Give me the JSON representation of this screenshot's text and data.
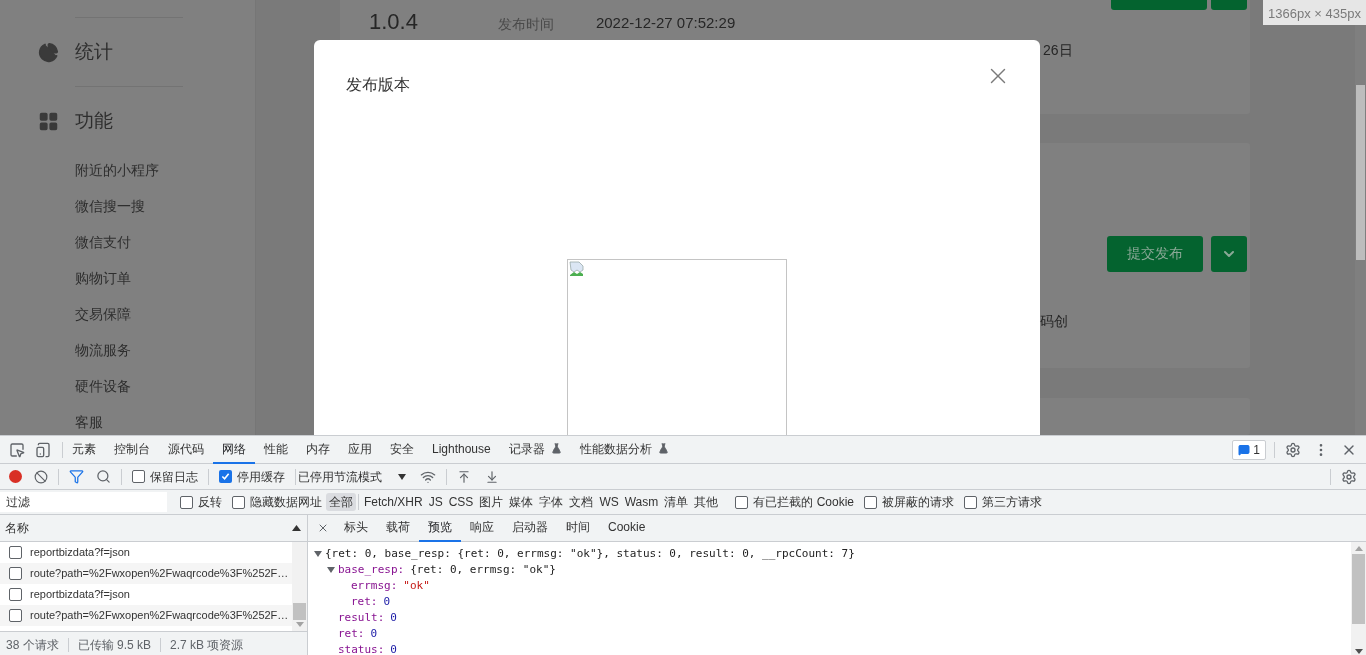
{
  "viewport_size": "1366px × 435px",
  "sidebar": {
    "groups": [
      {
        "kind": "stats",
        "label": "统计"
      },
      {
        "kind": "features",
        "label": "功能",
        "items": [
          "附近的小程序",
          "微信搜一搜",
          "微信支付",
          "购物订单",
          "交易保障",
          "物流服务",
          "硬件设备",
          "客服"
        ]
      }
    ]
  },
  "page": {
    "version": "1.0.4",
    "publish_time_label": "发布时间",
    "publish_time": "2022-12-27 07:52:29",
    "date_fragment": "26日",
    "text_fragment": "码创",
    "submit_button": "提交发布"
  },
  "dialog": {
    "title": "发布版本"
  },
  "devtools": {
    "tabs": [
      {
        "label": "元素",
        "selected": false,
        "experimental": false
      },
      {
        "label": "控制台",
        "selected": false,
        "experimental": false
      },
      {
        "label": "源代码",
        "selected": false,
        "experimental": false
      },
      {
        "label": "网络",
        "selected": true,
        "experimental": false
      },
      {
        "label": "性能",
        "selected": false,
        "experimental": false
      },
      {
        "label": "内存",
        "selected": false,
        "experimental": false
      },
      {
        "label": "应用",
        "selected": false,
        "experimental": false
      },
      {
        "label": "安全",
        "selected": false,
        "experimental": false
      },
      {
        "label": "Lighthouse",
        "selected": false,
        "experimental": false
      },
      {
        "label": "记录器",
        "selected": false,
        "experimental": true
      },
      {
        "label": "性能数据分析",
        "selected": false,
        "experimental": true
      }
    ],
    "issues_count": "1",
    "toolbar": {
      "recording": true,
      "filter_on": true,
      "checks": [
        {
          "label": "保留日志",
          "checked": false
        },
        {
          "label": "停用缓存",
          "checked": true
        }
      ],
      "throttling": "已停用节流模式"
    },
    "filter": {
      "placeholder": "过滤",
      "checks": [
        {
          "label": "反转",
          "checked": false
        },
        {
          "label": "隐藏数据网址",
          "checked": false
        }
      ],
      "types": [
        {
          "label": "全部",
          "selected": true
        },
        {
          "label": "Fetch/XHR",
          "selected": false
        },
        {
          "label": "JS",
          "selected": false
        },
        {
          "label": "CSS",
          "selected": false
        },
        {
          "label": "图片",
          "selected": false
        },
        {
          "label": "媒体",
          "selected": false
        },
        {
          "label": "字体",
          "selected": false
        },
        {
          "label": "文档",
          "selected": false
        },
        {
          "label": "WS",
          "selected": false
        },
        {
          "label": "Wasm",
          "selected": false
        },
        {
          "label": "清单",
          "selected": false
        },
        {
          "label": "其他",
          "selected": false
        }
      ],
      "extra_checks": [
        {
          "label": "有已拦截的 Cookie",
          "checked": false
        },
        {
          "label": "被屏蔽的请求",
          "checked": false
        },
        {
          "label": "第三方请求",
          "checked": false
        }
      ]
    },
    "requests": {
      "header": "名称",
      "rows": [
        {
          "name": "reportbizdata?f=json",
          "checked": false
        },
        {
          "name": "route?path=%2Fwxopen%2Fwaqrcode%3F%252F…",
          "checked": false
        },
        {
          "name": "reportbizdata?f=json",
          "checked": false
        },
        {
          "name": "route?path=%2Fwxopen%2Fwaqrcode%3F%252F…",
          "checked": false
        }
      ]
    },
    "status": [
      "38 个请求",
      "已传输 9.5 kB",
      "2.7 kB 项资源"
    ],
    "detail_tabs": [
      {
        "label": "标头",
        "selected": false
      },
      {
        "label": "载荷",
        "selected": false
      },
      {
        "label": "预览",
        "selected": true
      },
      {
        "label": "响应",
        "selected": false
      },
      {
        "label": "启动器",
        "selected": false
      },
      {
        "label": "时间",
        "selected": false
      },
      {
        "label": "Cookie",
        "selected": false
      }
    ],
    "preview": [
      {
        "kind": "object",
        "preview": "{ret: 0, base_resp: {ret: 0, errmsg: \"ok\"}, status: 0, result: 0, __rpcCount: 7}",
        "expanded": true,
        "children": [
          {
            "kind": "object",
            "key": "base_resp:",
            "preview": "{ret: 0, errmsg: \"ok\"}",
            "expanded": true,
            "children": [
              {
                "kind": "string",
                "key": "errmsg:",
                "value": "\"ok\""
              },
              {
                "kind": "number",
                "key": "ret:",
                "value": "0"
              }
            ]
          },
          {
            "kind": "number",
            "key": "result:",
            "value": "0"
          },
          {
            "kind": "number",
            "key": "ret:",
            "value": "0"
          },
          {
            "kind": "number",
            "key": "status:",
            "value": "0"
          }
        ]
      }
    ]
  }
}
